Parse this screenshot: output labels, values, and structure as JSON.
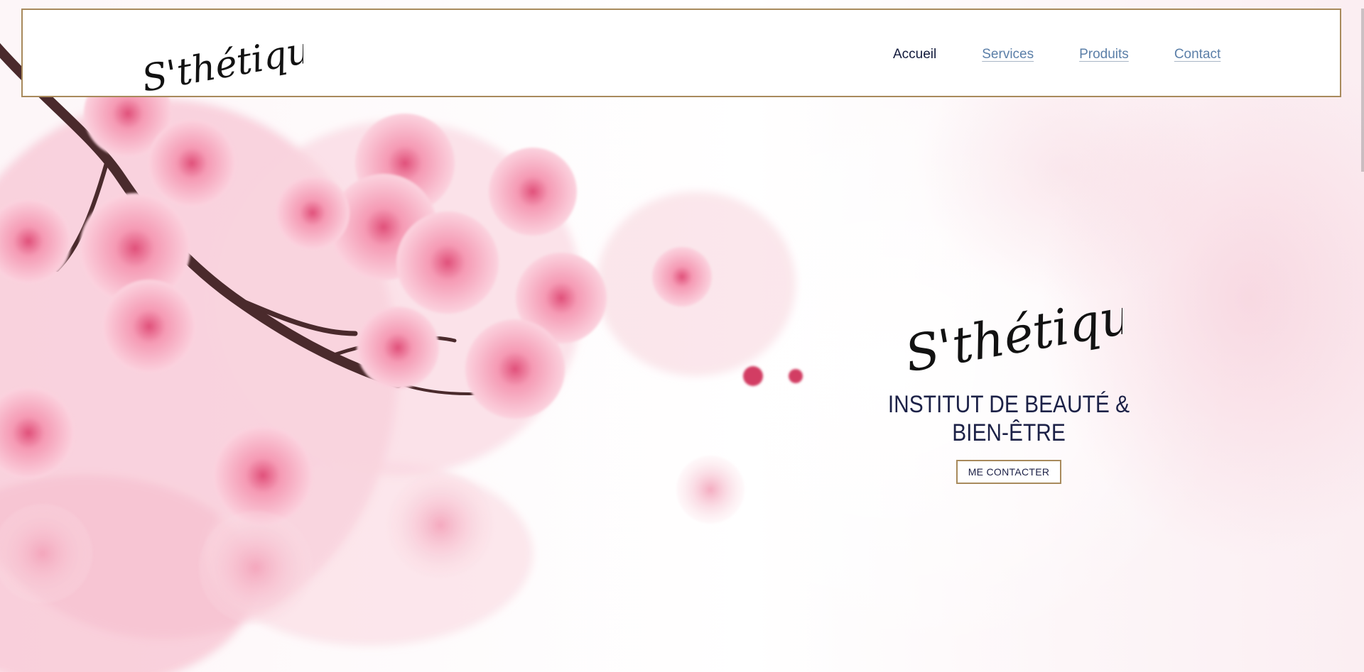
{
  "brand": {
    "logo_text": "S'thétique"
  },
  "nav": {
    "items": [
      {
        "label": "Accueil",
        "active": true
      },
      {
        "label": "Services",
        "active": false
      },
      {
        "label": "Produits",
        "active": false
      },
      {
        "label": "Contact",
        "active": false
      }
    ]
  },
  "hero": {
    "tagline_line1": "INSTITUT DE BEAUTÉ &",
    "tagline_line2": "BIEN-ÊTRE",
    "cta_label": "ME CONTACTER"
  },
  "colors": {
    "accent_gold": "#a88a5c",
    "navy": "#1c2147",
    "link_blue": "#5b7fa8",
    "blossom_pink": "#f2a7bd"
  }
}
